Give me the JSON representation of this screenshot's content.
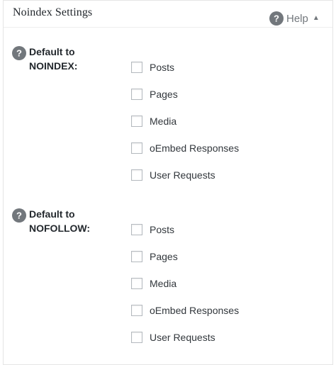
{
  "metabox": {
    "title": "Noindex Settings",
    "help": {
      "label": "Help",
      "icon": "question-circle-icon",
      "arrow": "▲"
    }
  },
  "sections": [
    {
      "label_line1": "Default to",
      "label_line2": "NOINDEX:",
      "icon": "question-circle-icon",
      "options": [
        {
          "label": "Posts",
          "checked": false
        },
        {
          "label": "Pages",
          "checked": false
        },
        {
          "label": "Media",
          "checked": false
        },
        {
          "label": "oEmbed Responses",
          "checked": false
        },
        {
          "label": "User Requests",
          "checked": false
        }
      ]
    },
    {
      "label_line1": "Default to",
      "label_line2": "NOFOLLOW:",
      "icon": "question-circle-icon",
      "options": [
        {
          "label": "Posts",
          "checked": false
        },
        {
          "label": "Pages",
          "checked": false
        },
        {
          "label": "Media",
          "checked": false
        },
        {
          "label": "oEmbed Responses",
          "checked": false
        },
        {
          "label": "User Requests",
          "checked": false
        }
      ]
    }
  ],
  "colors": {
    "icon_gray": "#72777c",
    "text": "#23282d",
    "checkbox_border": "#b4b9be",
    "border": "#e5e5e5"
  }
}
